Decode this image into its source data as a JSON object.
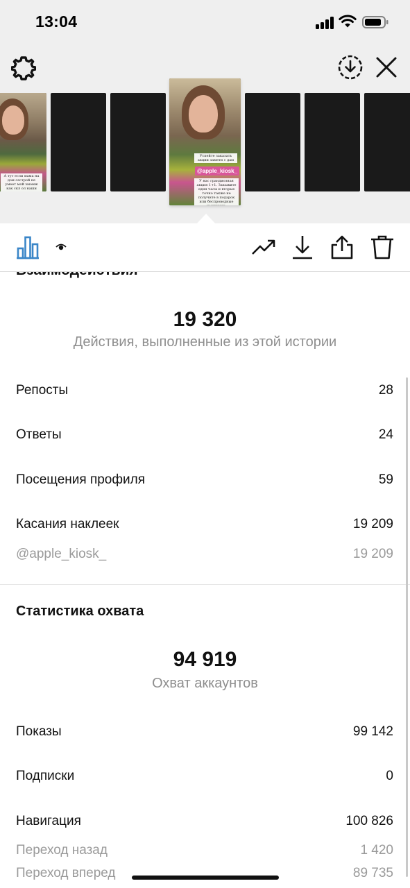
{
  "status_bar": {
    "time": "13:04"
  },
  "thumbnails": {
    "captions": {
      "left": "А тут если мама на дом сестрой не умеет мой змомж как скл ол наши",
      "active_top": "Успейте заказать акции замети с дам",
      "active_bottom": "У нас грандиозная акция 1+1. Закажите один часы и вторые точно также не получите в подарок или беспроводные наушники."
    },
    "sticker_tag": "@apple_kiosk_"
  },
  "interactions": {
    "heading": "Взаимодействия",
    "total": "19 320",
    "total_label": "Действия, выполненные из этой истории",
    "rows": [
      {
        "label": "Репосты",
        "value": "28"
      },
      {
        "label": "Ответы",
        "value": "24"
      },
      {
        "label": "Посещения профиля",
        "value": "59"
      },
      {
        "label": "Касания наклеек",
        "value": "19 209"
      }
    ],
    "sticker_row": {
      "label": "@apple_kiosk_",
      "value": "19 209"
    }
  },
  "reach": {
    "heading": "Статистика охвата",
    "total": "94 919",
    "total_label": "Охват аккаунтов",
    "rows": [
      {
        "label": "Показы",
        "value": "99 142"
      },
      {
        "label": "Подписки",
        "value": "0"
      },
      {
        "label": "Навигация",
        "value": "100 826"
      }
    ],
    "sub_rows": [
      {
        "label": "Переход назад",
        "value": "1 420"
      },
      {
        "label": "Переход вперед",
        "value": "89 735"
      }
    ]
  },
  "colors": {
    "accent": "#0095f6",
    "muted_text": "#8e8e8e",
    "sticker_pink": "#d9569a"
  },
  "icons": [
    "gear-icon",
    "download-circle-icon",
    "close-icon",
    "insights-bar-icon",
    "eye-icon",
    "trending-icon",
    "download-icon",
    "share-icon",
    "trash-icon"
  ]
}
